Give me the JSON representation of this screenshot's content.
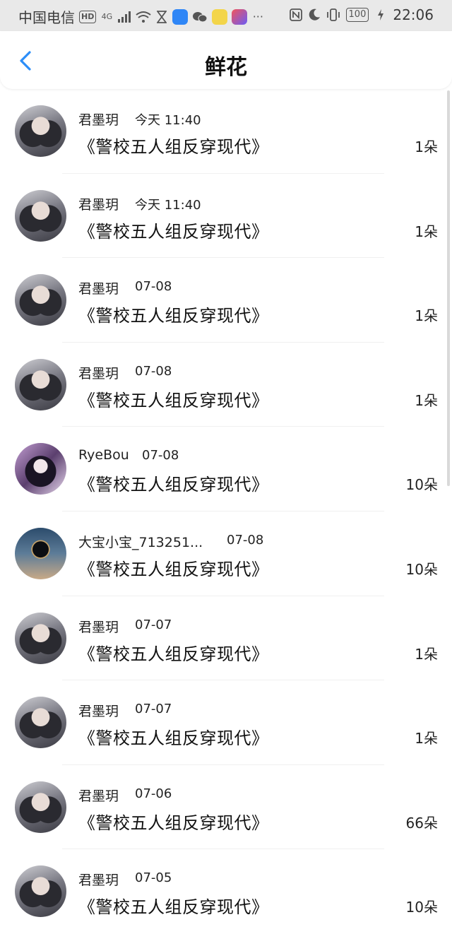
{
  "statusbar": {
    "carrier": "中国电信",
    "hd": "HD",
    "network": "4G",
    "battery": "100",
    "time": "22:06"
  },
  "header": {
    "title": "鲜花"
  },
  "colors": {
    "back_accent": "#2c8ef8",
    "statusbar_bg": "#e9e9e9"
  },
  "list": [
    {
      "name": "君墨玥",
      "time": "今天 11:40",
      "book": "《警校五人组反穿现代》",
      "count": "1朵",
      "avatar": "girl"
    },
    {
      "name": "君墨玥",
      "time": "今天 11:40",
      "book": "《警校五人组反穿现代》",
      "count": "1朵",
      "avatar": "girl"
    },
    {
      "name": "君墨玥",
      "time": "07-08",
      "book": "《警校五人组反穿现代》",
      "count": "1朵",
      "avatar": "girl"
    },
    {
      "name": "君墨玥",
      "time": "07-08",
      "book": "《警校五人组反穿现代》",
      "count": "1朵",
      "avatar": "girl"
    },
    {
      "name": "RyeBou",
      "time": "07-08",
      "book": "《警校五人组反穿现代》",
      "count": "10朵",
      "avatar": "rye"
    },
    {
      "name": "大宝小宝_713251...",
      "time": "07-08",
      "book": "《警校五人组反穿现代》",
      "count": "10朵",
      "avatar": "space"
    },
    {
      "name": "君墨玥",
      "time": "07-07",
      "book": "《警校五人组反穿现代》",
      "count": "1朵",
      "avatar": "girl"
    },
    {
      "name": "君墨玥",
      "time": "07-07",
      "book": "《警校五人组反穿现代》",
      "count": "1朵",
      "avatar": "girl"
    },
    {
      "name": "君墨玥",
      "time": "07-06",
      "book": "《警校五人组反穿现代》",
      "count": "66朵",
      "avatar": "girl"
    },
    {
      "name": "君墨玥",
      "time": "07-05",
      "book": "《警校五人组反穿现代》",
      "count": "10朵",
      "avatar": "girl"
    }
  ]
}
